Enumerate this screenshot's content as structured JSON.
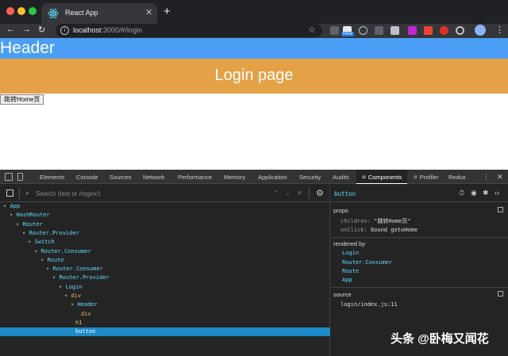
{
  "browser": {
    "tab_title": "React App",
    "tab_close": "✕",
    "new_tab": "+",
    "url_host": "localhost",
    "url_rest": ":3000/#/login",
    "nav_back": "←",
    "nav_forward": "→",
    "nav_reload": "↻",
    "bookmark": "☆",
    "ext_badge": "New",
    "menu": "⋮"
  },
  "page": {
    "header": "Header",
    "hero_title": "Login page",
    "button_label": "跳转Home页"
  },
  "devtools": {
    "tabs": [
      "Elements",
      "Console",
      "Sources",
      "Network",
      "Performance",
      "Memory",
      "Application",
      "Security",
      "Audits",
      "⚛ Components",
      "⚛ Profiler",
      "Redux"
    ],
    "menu": "⋮",
    "close": "✕",
    "search_placeholder": "Search (text or /regex/)",
    "search_up": "⌃",
    "search_down": "⌄",
    "search_clear": "✕",
    "settings": "⚙",
    "tree": [
      {
        "label": "App",
        "tri": "▾ "
      },
      {
        "label": "HashRouter",
        "tri": "▾ "
      },
      {
        "label": "Router",
        "tri": "▾ "
      },
      {
        "label": "Router.Provider",
        "tri": "▾ "
      },
      {
        "label": "Switch",
        "tri": "▾ "
      },
      {
        "label": "Router.Consumer",
        "tri": "▾ "
      },
      {
        "label": "Route",
        "tri": "▾ "
      },
      {
        "label": "Router.Consumer",
        "tri": "▾ "
      },
      {
        "label": "Router.Provider",
        "tri": "▾ "
      },
      {
        "label": "Login",
        "tri": "▾ "
      },
      {
        "label": "div",
        "tri": "▾ "
      },
      {
        "label": "Header",
        "tri": "▾ "
      },
      {
        "label": "div",
        "tri": ""
      },
      {
        "label": "h1",
        "tri": ""
      },
      {
        "label": "button",
        "tri": ""
      }
    ],
    "selected": {
      "name": "button",
      "props_title": "props",
      "prop1_key": "children:",
      "prop1_val": "\"跳转Home页\"",
      "prop2_key": "onClick:",
      "prop2_val": "bound gotoHome",
      "rendered_by_title": "rendered by",
      "rendered_by": [
        "Login",
        "Router.Consumer",
        "Route",
        "App"
      ],
      "source_title": "source",
      "source": "login/index.js:11"
    }
  },
  "watermark": "头条 @卧梅又闻花"
}
